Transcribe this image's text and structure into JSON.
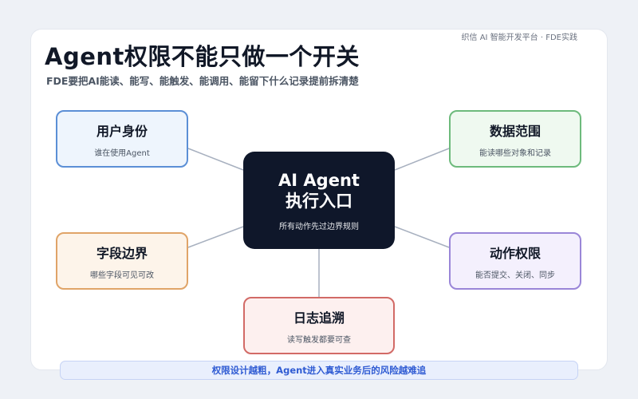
{
  "header": {
    "title": "Agent权限不能只做一个开关",
    "subtitle": "FDE要把AI能读、能写、能触发、能调用、能留下什么记录提前拆清楚",
    "brand": "织信 AI 智能开发平台 · FDE实践"
  },
  "center": {
    "title_line1": "AI Agent",
    "title_line2": "执行入口",
    "caption": "所有动作先过边界规则"
  },
  "nodes": {
    "user": {
      "title": "用户身份",
      "caption": "谁在使用Agent"
    },
    "data": {
      "title": "数据范围",
      "caption": "能读哪些对象和记录"
    },
    "field": {
      "title": "字段边界",
      "caption": "哪些字段可见可改"
    },
    "action": {
      "title": "动作权限",
      "caption": "能否提交、关闭、同步"
    },
    "log": {
      "title": "日志追溯",
      "caption": "读写触发都要可查"
    }
  },
  "footer": {
    "banner": "权限设计越粗，Agent进入真实业务后的风险越难追"
  },
  "colors": {
    "center_bg": "#0f172a",
    "user_border": "#5b8fd6",
    "data_border": "#6dba7c",
    "field_border": "#e0a468",
    "action_border": "#9a86d8",
    "log_border": "#d26a66",
    "banner_text": "#2f5bd3"
  }
}
